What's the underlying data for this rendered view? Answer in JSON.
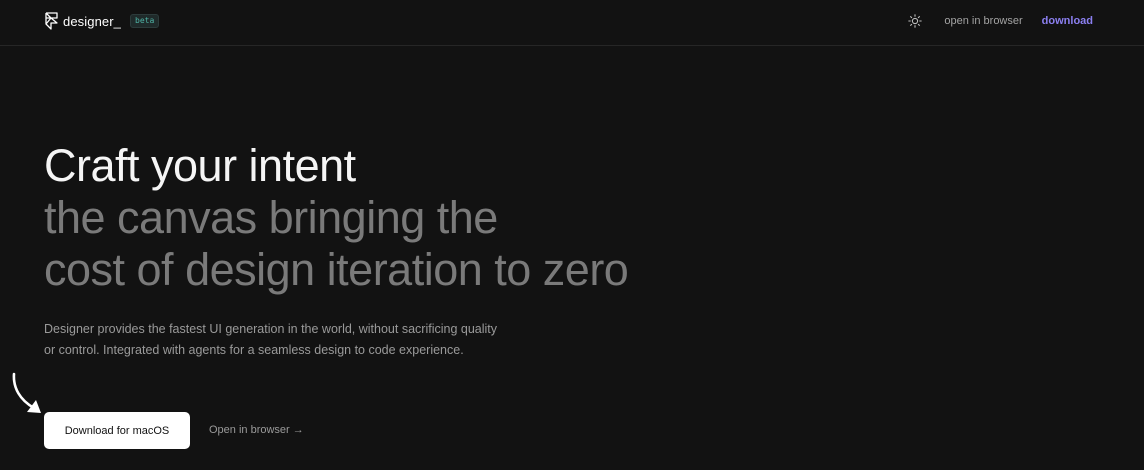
{
  "nav": {
    "brand_name": "designer_",
    "beta_label": "beta",
    "theme_icon": "sun-icon",
    "open_in_browser": "open in browser",
    "download": "download",
    "accent_color": "#8b7ff0"
  },
  "hero": {
    "title_line1": "Craft your intent",
    "title_line2": "the canvas bringing the",
    "title_line3": "cost of design iteration to zero",
    "description": "Designer provides the fastest UI generation in the world, without sacrificing quality or control. Integrated with agents for a seamless design to code experience.",
    "primary_button": "Download for macOS",
    "secondary_link": "Open in browser →",
    "annotation_icon": "curved-arrow-icon"
  }
}
